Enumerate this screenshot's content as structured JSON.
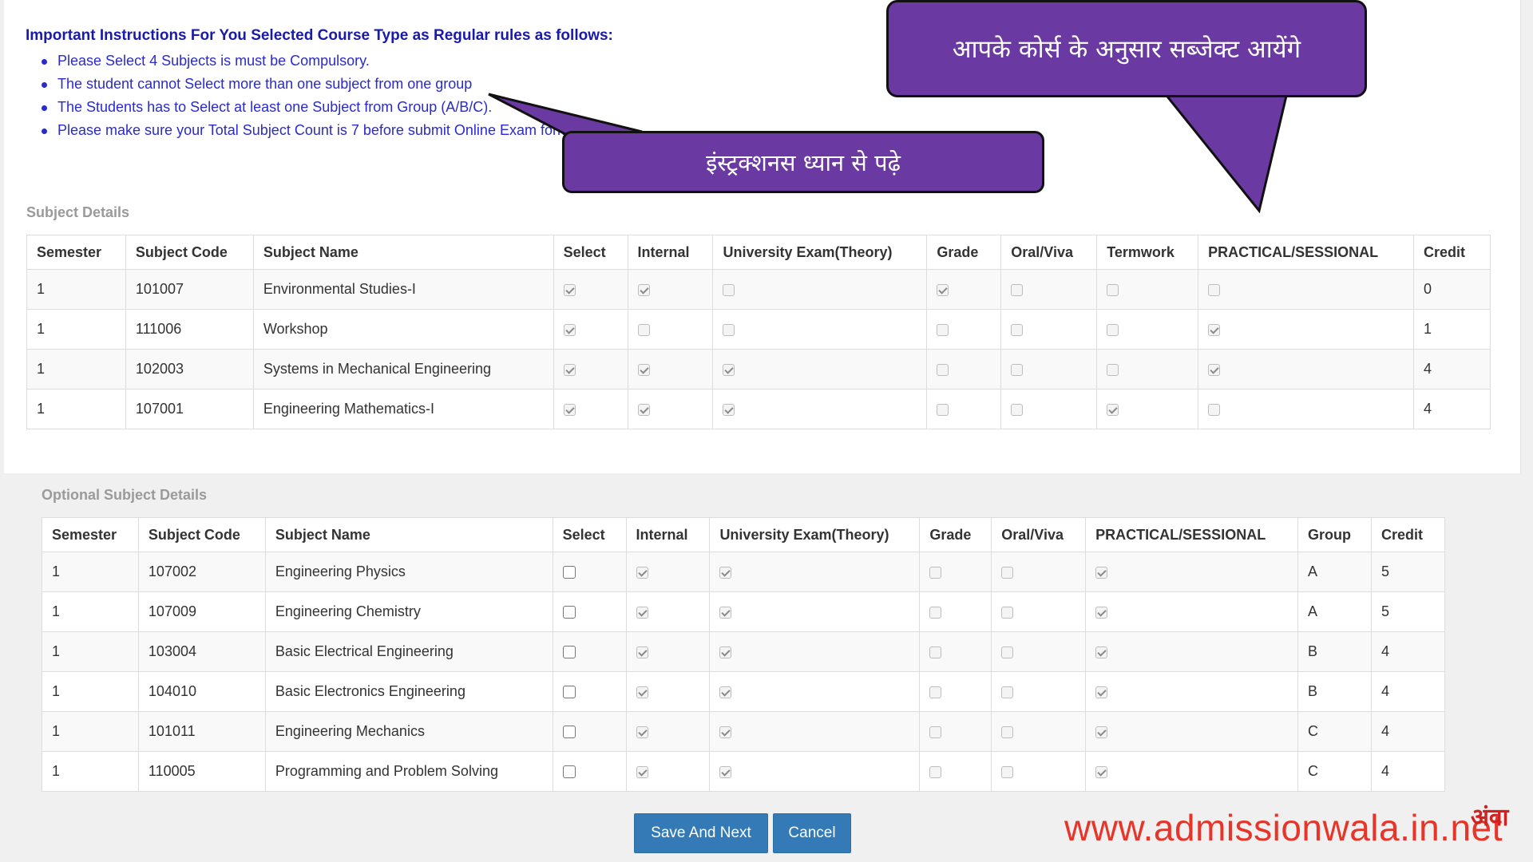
{
  "instructions": {
    "title": "Important Instructions For You Selected Course Type as Regular rules as follows:",
    "items": [
      "Please Select 4 Subjects is must be Compulsory.",
      "The student cannot Select more than one subject from one group",
      "The Students has to Select at least one Subject from Group (A/B/C).",
      "Please make sure your Total Subject Count is 7 before submit Online Exam form"
    ]
  },
  "annotations": {
    "bubble_top": "आपके कोर्स के अनुसार सब्जेक्ट आयेंगे",
    "bubble_mid": "इंस्ट्रक्शनस ध्यान से पढ़े"
  },
  "subject_details": {
    "label": "Subject Details",
    "headers": [
      "Semester",
      "Subject Code",
      "Subject Name",
      "Select",
      "Internal",
      "University Exam(Theory)",
      "Grade",
      "Oral/Viva",
      "Termwork",
      "PRACTICAL/SESSIONAL",
      "Credit"
    ],
    "rows": [
      {
        "semester": "1",
        "code": "101007",
        "name": "Environmental Studies-I",
        "select": true,
        "internal": true,
        "theory": false,
        "grade": true,
        "oral": false,
        "termwork": false,
        "practical": false,
        "credit": "0"
      },
      {
        "semester": "1",
        "code": "111006",
        "name": "Workshop",
        "select": true,
        "internal": false,
        "theory": false,
        "grade": false,
        "oral": false,
        "termwork": false,
        "practical": true,
        "credit": "1"
      },
      {
        "semester": "1",
        "code": "102003",
        "name": "Systems in Mechanical Engineering",
        "select": true,
        "internal": true,
        "theory": true,
        "grade": false,
        "oral": false,
        "termwork": false,
        "practical": true,
        "credit": "4"
      },
      {
        "semester": "1",
        "code": "107001",
        "name": "Engineering Mathematics-I",
        "select": true,
        "internal": true,
        "theory": true,
        "grade": false,
        "oral": false,
        "termwork": true,
        "practical": false,
        "credit": "4"
      }
    ]
  },
  "optional_subjects": {
    "label": "Optional Subject Details",
    "headers": [
      "Semester",
      "Subject Code",
      "Subject Name",
      "Select",
      "Internal",
      "University Exam(Theory)",
      "Grade",
      "Oral/Viva",
      "PRACTICAL/SESSIONAL",
      "Group",
      "Credit"
    ],
    "rows": [
      {
        "semester": "1",
        "code": "107002",
        "name": "Engineering Physics",
        "select": false,
        "internal": true,
        "theory": true,
        "grade": false,
        "oral": false,
        "practical": true,
        "group": "A",
        "credit": "5"
      },
      {
        "semester": "1",
        "code": "107009",
        "name": "Engineering Chemistry",
        "select": false,
        "internal": true,
        "theory": true,
        "grade": false,
        "oral": false,
        "practical": true,
        "group": "A",
        "credit": "5"
      },
      {
        "semester": "1",
        "code": "103004",
        "name": "Basic Electrical Engineering",
        "select": false,
        "internal": true,
        "theory": true,
        "grade": false,
        "oral": false,
        "practical": true,
        "group": "B",
        "credit": "4"
      },
      {
        "semester": "1",
        "code": "104010",
        "name": "Basic Electronics Engineering",
        "select": false,
        "internal": true,
        "theory": true,
        "grade": false,
        "oral": false,
        "practical": true,
        "group": "B",
        "credit": "4"
      },
      {
        "semester": "1",
        "code": "101011",
        "name": "Engineering Mechanics",
        "select": false,
        "internal": true,
        "theory": true,
        "grade": false,
        "oral": false,
        "practical": true,
        "group": "C",
        "credit": "4"
      },
      {
        "semester": "1",
        "code": "110005",
        "name": "Programming and Problem Solving",
        "select": false,
        "internal": true,
        "theory": true,
        "grade": false,
        "oral": false,
        "practical": true,
        "group": "C",
        "credit": "4"
      }
    ]
  },
  "buttons": {
    "save_next": "Save And Next",
    "cancel": "Cancel"
  },
  "watermark": {
    "text": "www.admissionwala.in.net",
    "logo": "अंवा"
  },
  "colors": {
    "instruction_blue": "#2a2ad0",
    "bubble_purple": "#6a3aa2",
    "button_blue": "#337ab7",
    "watermark_red": "#e8352a"
  }
}
